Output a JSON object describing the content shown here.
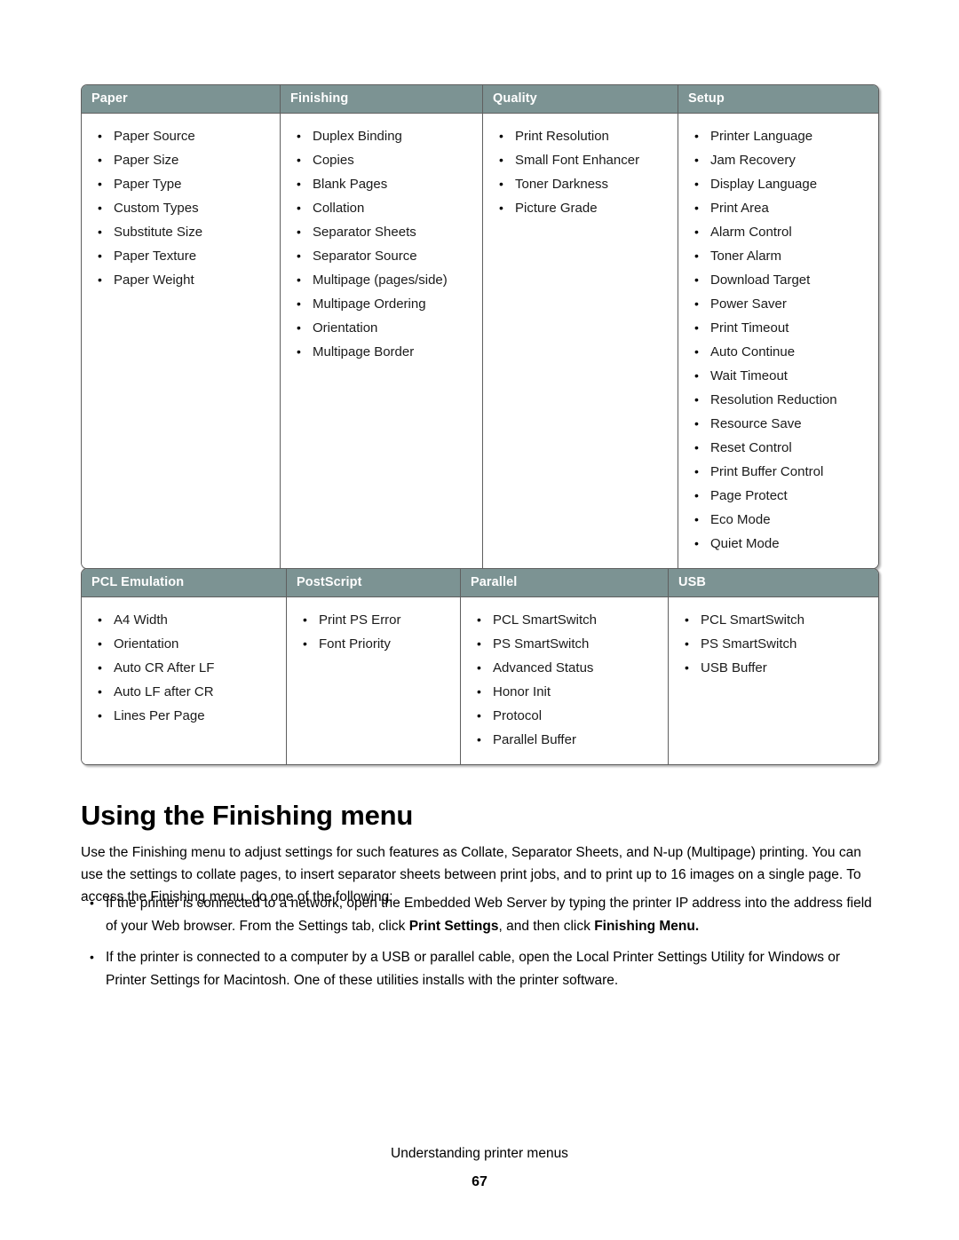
{
  "document": {
    "footer_caption": "Understanding printer menus",
    "page_number": "67"
  },
  "tables": [
    {
      "id": "print-menus",
      "columns": [
        {
          "header": "Paper",
          "items": [
            "Paper Source",
            "Paper Size",
            "Paper Type",
            "Custom Types",
            "Substitute Size",
            "Paper Texture",
            "Paper Weight"
          ]
        },
        {
          "header": "Finishing",
          "items": [
            "Duplex Binding",
            "Copies",
            "Blank Pages",
            "Collation",
            "Separator Sheets",
            "Separator Source",
            "Multipage (pages/side)",
            "Multipage Ordering",
            "Orientation",
            "Multipage Border"
          ]
        },
        {
          "header": "Quality",
          "items": [
            "Print Resolution",
            "Small Font Enhancer",
            "Toner Darkness",
            "Picture Grade"
          ]
        },
        {
          "header": "Setup",
          "items": [
            "Printer Language",
            "Jam Recovery",
            "Display Language",
            "Print Area",
            "Alarm Control",
            "Toner Alarm",
            "Download Target",
            "Power Saver",
            "Print Timeout",
            "Auto Continue",
            "Wait Timeout",
            "Resolution Reduction",
            "Resource Save",
            "Reset Control",
            "Print Buffer Control",
            "Page Protect",
            "Eco Mode",
            "Quiet Mode"
          ]
        }
      ]
    },
    {
      "id": "port-menus",
      "columns": [
        {
          "header": "PCL Emulation",
          "items": [
            "A4 Width",
            "Orientation",
            "Auto CR After LF",
            "Auto LF after CR",
            "Lines Per Page"
          ]
        },
        {
          "header": "PostScript",
          "items": [
            "Print PS Error",
            "Font Priority"
          ]
        },
        {
          "header": "Parallel",
          "items": [
            "PCL SmartSwitch",
            "PS SmartSwitch",
            "Advanced Status",
            "Honor Init",
            "Protocol",
            "Parallel Buffer"
          ]
        },
        {
          "header": "USB",
          "items": [
            "PCL SmartSwitch",
            "PS SmartSwitch",
            "USB Buffer"
          ]
        }
      ]
    }
  ],
  "section": {
    "heading": "Using the Finishing menu",
    "intro": "Use the Finishing menu to adjust settings for such features as Collate, Separator Sheets, and N-up (Multipage) printing. You can use the settings to collate pages, to insert separator sheets between print jobs, and to print up to 16 images on a single page. To access the Finishing menu, do one of the following:",
    "instructions": [
      {
        "parts": [
          {
            "text": "If the printer is connected to a network, open the Embedded Web Server by typing the printer IP address into the address field of your Web browser. From the Settings tab, click ",
            "bold": false
          },
          {
            "text": "Print Settings",
            "bold": true
          },
          {
            "text": ", and then click ",
            "bold": false
          },
          {
            "text": "Finishing Menu.",
            "bold": true
          }
        ]
      },
      {
        "parts": [
          {
            "text": "If the printer is connected to a computer by a USB or parallel cable, open the Local Printer Settings Utility for Windows or Printer Settings for Macintosh. One of these utilities installs with the printer software.",
            "bold": false
          }
        ]
      }
    ]
  },
  "colors": {
    "table_header_bg": "#7c9393",
    "table_header_text": "#ffffff",
    "table_border": "#5f5f5f",
    "body_text": "#000000",
    "page_bg": "#ffffff"
  }
}
